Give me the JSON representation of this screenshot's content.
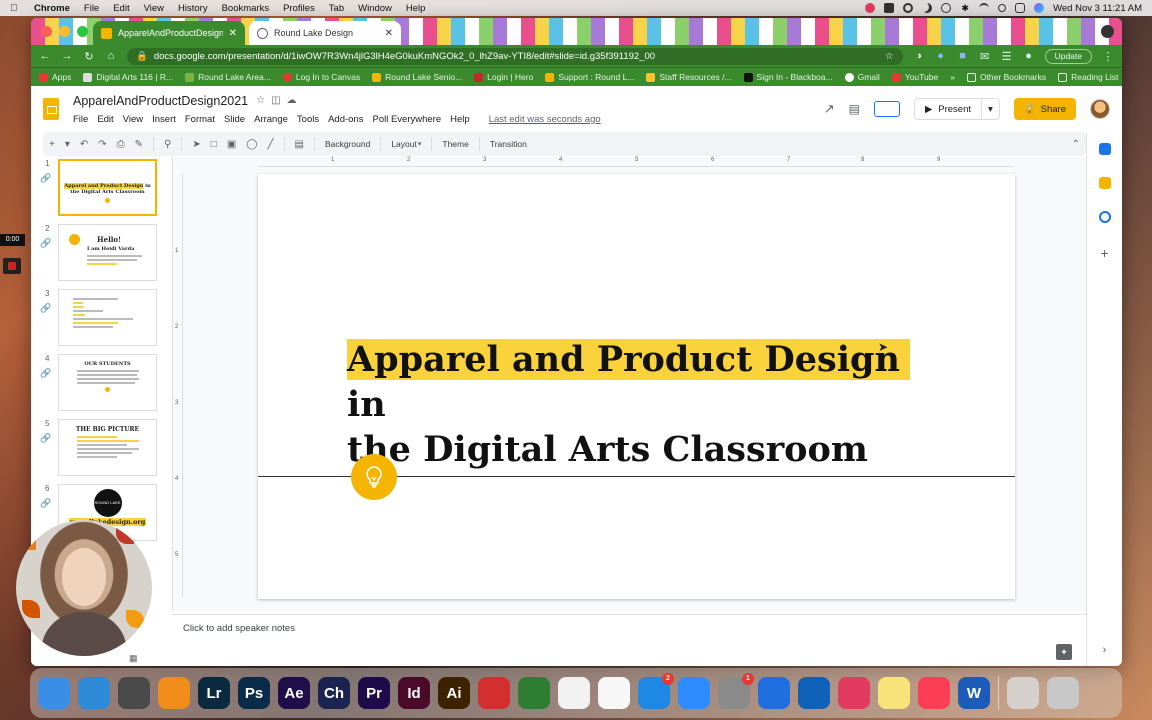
{
  "menubar": {
    "app": "Chrome",
    "items": [
      "File",
      "Edit",
      "View",
      "History",
      "Bookmarks",
      "Profiles",
      "Tab",
      "Window",
      "Help"
    ],
    "datetime": "Wed Nov 3  11:21 AM"
  },
  "browser": {
    "tabs": [
      {
        "label": "ApparelAndProductDesign202",
        "active": true
      },
      {
        "label": "Round Lake Design",
        "active": false
      }
    ],
    "url": "docs.google.com/presentation/d/1iwOW7R3Wn4jlG3lH4eG0kuKmNGOk2_0_lhZ9av-YTI8/edit#slide=id.g35f391192_00",
    "update_label": "Update",
    "bookmarks": [
      "Apps",
      "Digital Arts 116 | R...",
      "Round Lake Area...",
      "Log In to Canvas",
      "Round Lake Senio...",
      "Login | Hero",
      "Support : Round L...",
      "Staff Resources /...",
      "Sign In - Blackboa...",
      "Gmail",
      "YouTube"
    ],
    "bookmarks_more": "»",
    "other_bookmarks": "Other Bookmarks",
    "reading_list": "Reading List"
  },
  "docs": {
    "title": "ApparelAndProductDesign2021",
    "menus": [
      "File",
      "Edit",
      "View",
      "Insert",
      "Format",
      "Slide",
      "Arrange",
      "Tools",
      "Add-ons",
      "Poll Everywhere",
      "Help"
    ],
    "last_edit": "Last edit was seconds ago",
    "present_label": "Present",
    "share_label": "Share",
    "toolbar": {
      "background": "Background",
      "layout": "Layout",
      "theme": "Theme",
      "transition": "Transition"
    }
  },
  "filmstrip": {
    "slides": [
      {
        "num": "1",
        "line1": "Apparel and Product Design",
        "line1_tail": " in",
        "line2": "the Digital Arts Classroom"
      },
      {
        "num": "2",
        "hello": "Hello!",
        "iam": "I am Heidi Varda"
      },
      {
        "num": "3"
      },
      {
        "num": "4",
        "title": "OUR STUDENTS"
      },
      {
        "num": "5",
        "title": "THE BIG PICTURE"
      },
      {
        "num": "6",
        "circle": "ROUND LAKE DESIGN",
        "url": "roundlakedesign.org"
      }
    ]
  },
  "slide": {
    "title_highlight": "Apparel and Product Design",
    "title_tail": " in",
    "title_line2": "the Digital Arts Classroom"
  },
  "ruler": {
    "h_ticks": [
      "1",
      "2",
      "3",
      "4",
      "5",
      "6",
      "7",
      "8",
      "9"
    ],
    "v_ticks": [
      "1",
      "2",
      "3",
      "4",
      "5"
    ]
  },
  "notes_placeholder": "Click to add speaker notes",
  "timer": "0:00",
  "dock": {
    "apps": [
      {
        "name": "finder",
        "label": "",
        "color": "#3a8ee6"
      },
      {
        "name": "safari",
        "label": "",
        "color": "#2f8ad8"
      },
      {
        "name": "quicktime",
        "label": "",
        "color": "#4a4a4a"
      },
      {
        "name": "vlc",
        "label": "",
        "color": "#f08c1a"
      },
      {
        "name": "lightroom",
        "label": "Lr",
        "color": "#0b2a3f"
      },
      {
        "name": "photoshop",
        "label": "Ps",
        "color": "#0a2c4a"
      },
      {
        "name": "after-effects",
        "label": "Ae",
        "color": "#1f0e4a"
      },
      {
        "name": "character",
        "label": "Ch",
        "color": "#1b2450"
      },
      {
        "name": "premiere",
        "label": "Pr",
        "color": "#1d0b4a"
      },
      {
        "name": "indesign",
        "label": "Id",
        "color": "#4a0b2a"
      },
      {
        "name": "illustrator",
        "label": "Ai",
        "color": "#3d2200"
      },
      {
        "name": "acrobat",
        "label": "",
        "color": "#d32f2f"
      },
      {
        "name": "animate",
        "label": "",
        "color": "#2e7d32"
      },
      {
        "name": "chrome",
        "label": "",
        "color": "#f1f1f1"
      },
      {
        "name": "photos",
        "label": "",
        "color": "#f7f7f7"
      },
      {
        "name": "app-store",
        "label": "",
        "color": "#1e88e5",
        "badge": "2"
      },
      {
        "name": "zoom",
        "label": "",
        "color": "#2d8cff"
      },
      {
        "name": "system-preferences",
        "label": "",
        "color": "#8a8a8a",
        "badge": "1"
      },
      {
        "name": "dropbox",
        "label": "",
        "color": "#1f6fe0"
      },
      {
        "name": "outlook",
        "label": "",
        "color": "#0f62b7"
      },
      {
        "name": "creative-cloud",
        "label": "",
        "color": "#e13b5f"
      },
      {
        "name": "notes",
        "label": "",
        "color": "#f8e27a"
      },
      {
        "name": "music",
        "label": "",
        "color": "#fb3e55"
      },
      {
        "name": "word",
        "label": "W",
        "color": "#1e5bb8"
      },
      {
        "name": "desktop-car",
        "label": "",
        "color": "#d6d0cc"
      },
      {
        "name": "trash",
        "label": "",
        "color": "#c8c8c8"
      }
    ]
  },
  "colors": {
    "accent_yellow": "#f4b400",
    "highlight": "#f9d23c",
    "chrome_theme": "#3c8a2e"
  }
}
